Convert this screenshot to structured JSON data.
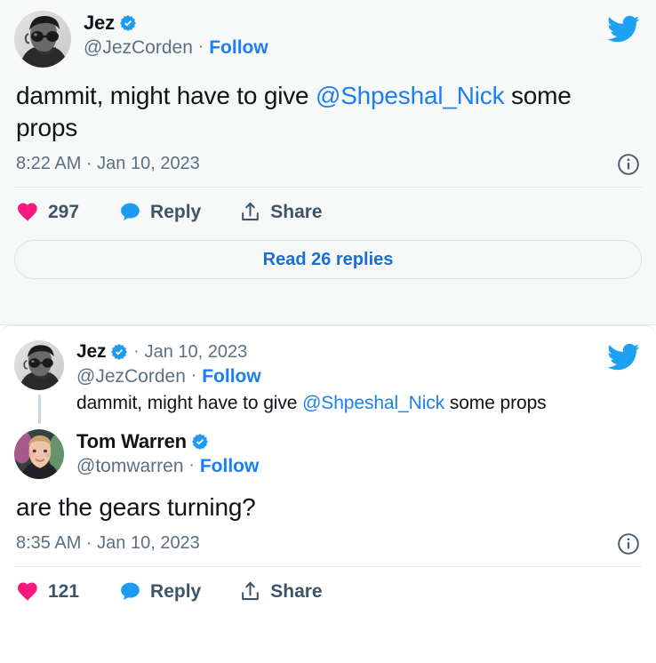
{
  "theme": {
    "accent_blue": "#1b7ff0",
    "link_blue": "#1b6fd4",
    "bird_blue": "#1da1f2",
    "like_pink": "#f91880",
    "reply_blue": "#1d9bf0",
    "text_primary": "#0f1419",
    "text_muted": "#5b7083",
    "card_tint": "#f7f9f9",
    "border": "#e2e8ed"
  },
  "embedded_tweet": {
    "author": {
      "display_name": "Jez",
      "handle": "@JezCorden",
      "verified": true,
      "verified_icon": "verified-badge-icon",
      "avatar_alt": "jez-corden-avatar"
    },
    "follow_label": "Follow",
    "separator": "·",
    "brand_icon": "twitter-bird-icon",
    "text_parts": {
      "before": "dammit, might have to give ",
      "mention": "@Shpeshal_Nick",
      "after": " some props"
    },
    "timestamp": "8:22 AM · Jan 10, 2023",
    "info_icon": "info-circle-icon",
    "actions": {
      "like": {
        "icon": "heart-icon",
        "count": "297"
      },
      "reply": {
        "icon": "reply-bubble-icon",
        "label": "Reply"
      },
      "share": {
        "icon": "share-upload-icon",
        "label": "Share"
      }
    },
    "read_replies_label": "Read 26 replies"
  },
  "thread_tweet": {
    "quoted": {
      "author": {
        "display_name": "Jez",
        "handle": "@JezCorden",
        "verified": true,
        "verified_icon": "verified-badge-icon",
        "avatar_alt": "jez-corden-avatar"
      },
      "date": "Jan 10, 2023",
      "follow_label": "Follow",
      "separator": "·",
      "text_parts": {
        "before": "dammit, might have to give ",
        "mention": "@Shpeshal_Nick",
        "after": " some props"
      }
    },
    "author": {
      "display_name": "Tom Warren",
      "handle": "@tomwarren",
      "verified": true,
      "verified_icon": "verified-badge-icon",
      "avatar_alt": "tom-warren-avatar"
    },
    "follow_label": "Follow",
    "separator": "·",
    "brand_icon": "twitter-bird-icon",
    "text": "are the gears turning?",
    "timestamp": "8:35 AM · Jan 10, 2023",
    "info_icon": "info-circle-icon",
    "actions": {
      "like": {
        "icon": "heart-icon",
        "count": "121"
      },
      "reply": {
        "icon": "reply-bubble-icon",
        "label": "Reply"
      },
      "share": {
        "icon": "share-upload-icon",
        "label": "Share"
      }
    }
  }
}
